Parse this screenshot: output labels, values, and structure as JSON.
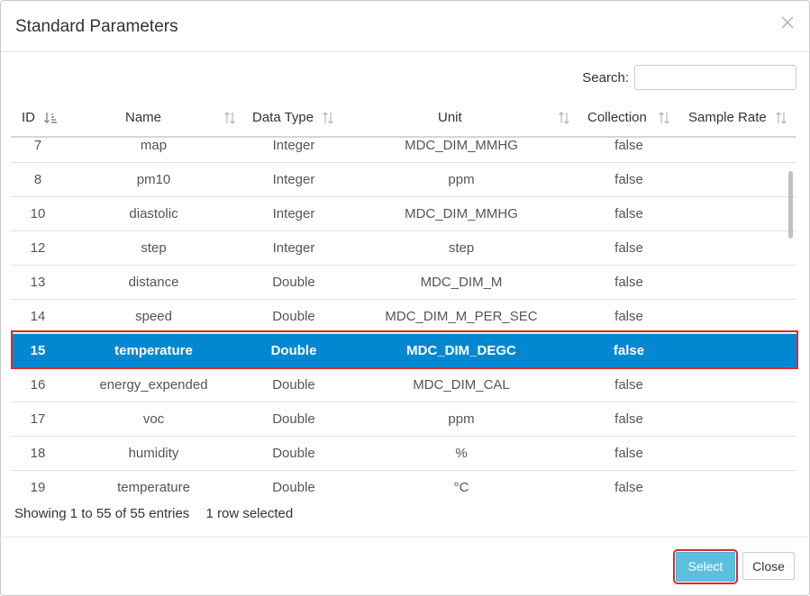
{
  "dialog": {
    "title": "Standard Parameters",
    "close_icon": "close-icon"
  },
  "search": {
    "label": "Search:",
    "value": "",
    "placeholder": ""
  },
  "table": {
    "columns": [
      "ID",
      "Name",
      "Data Type",
      "Unit",
      "Collection",
      "Sample Rate"
    ],
    "rows": [
      {
        "id": "7",
        "name": "map",
        "type": "Integer",
        "unit": "MDC_DIM_MMHG",
        "collection": "false",
        "rate": ""
      },
      {
        "id": "8",
        "name": "pm10",
        "type": "Integer",
        "unit": "ppm",
        "collection": "false",
        "rate": ""
      },
      {
        "id": "10",
        "name": "diastolic",
        "type": "Integer",
        "unit": "MDC_DIM_MMHG",
        "collection": "false",
        "rate": ""
      },
      {
        "id": "12",
        "name": "step",
        "type": "Integer",
        "unit": "step",
        "collection": "false",
        "rate": ""
      },
      {
        "id": "13",
        "name": "distance",
        "type": "Double",
        "unit": "MDC_DIM_M",
        "collection": "false",
        "rate": ""
      },
      {
        "id": "14",
        "name": "speed",
        "type": "Double",
        "unit": "MDC_DIM_M_PER_SEC",
        "collection": "false",
        "rate": ""
      },
      {
        "id": "15",
        "name": "temperature",
        "type": "Double",
        "unit": "MDC_DIM_DEGC",
        "collection": "false",
        "rate": "",
        "selected": true
      },
      {
        "id": "16",
        "name": "energy_expended",
        "type": "Double",
        "unit": "MDC_DIM_CAL",
        "collection": "false",
        "rate": ""
      },
      {
        "id": "17",
        "name": "voc",
        "type": "Double",
        "unit": "ppm",
        "collection": "false",
        "rate": ""
      },
      {
        "id": "18",
        "name": "humidity",
        "type": "Double",
        "unit": "%",
        "collection": "false",
        "rate": ""
      },
      {
        "id": "19",
        "name": "temperature",
        "type": "Double",
        "unit": "°C",
        "collection": "false",
        "rate": ""
      }
    ]
  },
  "info": {
    "entries": "Showing 1 to 55 of 55 entries",
    "selected": "1 row selected"
  },
  "buttons": {
    "select": "Select",
    "close": "Close"
  },
  "colors": {
    "selected_row": "#0288d1",
    "highlight_outline": "#e0262c",
    "select_button": "#5bc0de"
  }
}
